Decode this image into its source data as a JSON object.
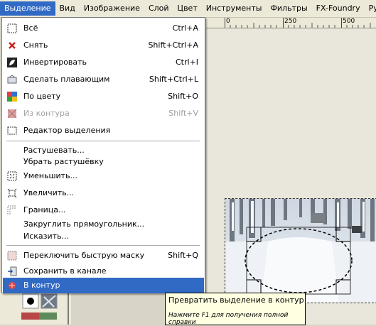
{
  "menubar": {
    "items": [
      "Выделение",
      "Вид",
      "Изображение",
      "Слой",
      "Цвет",
      "Инструменты",
      "Фильтры",
      "FX-Foundry",
      "Python-F"
    ]
  },
  "ruler": {
    "labels": [
      "0",
      "250",
      "500"
    ]
  },
  "menu": {
    "items": [
      {
        "label": "Всё",
        "shortcut": "Ctrl+A",
        "icon": "select-all-icon"
      },
      {
        "label": "Снять",
        "shortcut": "Shift+Ctrl+A",
        "icon": "close-icon"
      },
      {
        "label": "Инвертировать",
        "shortcut": "Ctrl+I",
        "icon": "invert-icon"
      },
      {
        "label": "Сделать плавающим",
        "shortcut": "Shift+Ctrl+L",
        "icon": "float-icon"
      },
      {
        "label": "По цвету",
        "shortcut": "Shift+O",
        "icon": "by-color-icon"
      },
      {
        "label": "Из контура",
        "shortcut": "Shift+V",
        "icon": "from-path-icon"
      },
      {
        "label": "Редактор выделения",
        "shortcut": "",
        "icon": "selection-editor-icon"
      },
      {
        "label": "Растушевать...",
        "shortcut": "",
        "icon": ""
      },
      {
        "label": "Убрать растушёвку",
        "shortcut": "",
        "icon": ""
      },
      {
        "label": "Уменьшить...",
        "shortcut": "",
        "icon": "shrink-icon"
      },
      {
        "label": "Увеличить...",
        "shortcut": "",
        "icon": "grow-icon"
      },
      {
        "label": "Граница...",
        "shortcut": "",
        "icon": "border-icon"
      },
      {
        "label": "Закруглить прямоугольник...",
        "shortcut": "",
        "icon": ""
      },
      {
        "label": "Исказить...",
        "shortcut": "",
        "icon": ""
      },
      {
        "label": "Переключить быструю маску",
        "shortcut": "Shift+Q",
        "icon": "quick-mask-icon"
      },
      {
        "label": "Сохранить в канале",
        "shortcut": "",
        "icon": "save-channel-icon"
      },
      {
        "label": "В контур",
        "shortcut": "",
        "icon": "to-path-icon"
      }
    ]
  },
  "tooltip": {
    "text": "Превратить выделение в контур",
    "hint": "Нажмите F1 для получения полной справки"
  }
}
